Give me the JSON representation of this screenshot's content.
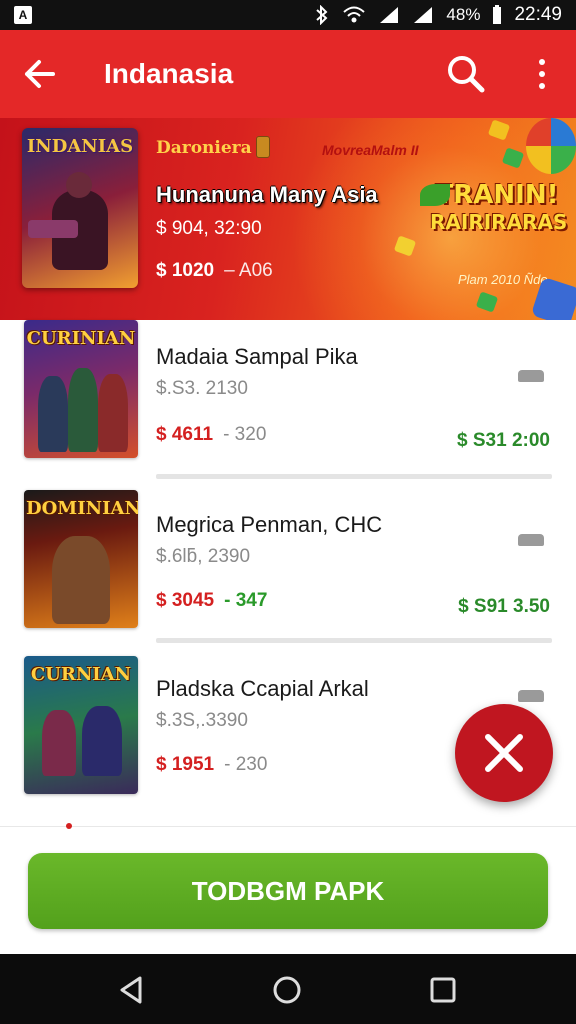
{
  "status_bar": {
    "battery": "48%",
    "time": "22:49"
  },
  "app_bar": {
    "title": "Indanasia"
  },
  "featured": {
    "cover_title": "INDANIAS",
    "brand": "Daroniera",
    "promo": "MovreaMalm II",
    "name": "Hunanuna Many Asia",
    "line1": "$ 904, 32:90",
    "line2_main": "$ 1020",
    "line2_dim": "– A06",
    "game_title_1": "TRANIN!",
    "game_title_2": "RAIRIRARAS",
    "tagline": "Plam 2010 Ñde"
  },
  "items": [
    {
      "thumb_title": "CURINIAN",
      "title": "Madaia Sampal Pika",
      "sub": "$.S3. 2130",
      "price_red": "$ 4611",
      "price_other": "- 320",
      "price_other_color": "gray",
      "total": "$ S31 2:00"
    },
    {
      "thumb_title": "DOMINIAN",
      "title": "Megrica Penman, CHC",
      "sub": "$.6lƃ, 2390",
      "price_red": "$ 3045",
      "price_other": "- 347",
      "price_other_color": "green",
      "total": "$ S91 3.50"
    },
    {
      "thumb_title": "CURNIAN",
      "title": "Pladska Ccapial Arkal",
      "sub": "$.3S,.3390",
      "price_red": "$ 1951",
      "price_other": "- 230",
      "price_other_color": "gray",
      "total": ""
    }
  ],
  "cta": {
    "label": "TODBGM PAPK"
  }
}
